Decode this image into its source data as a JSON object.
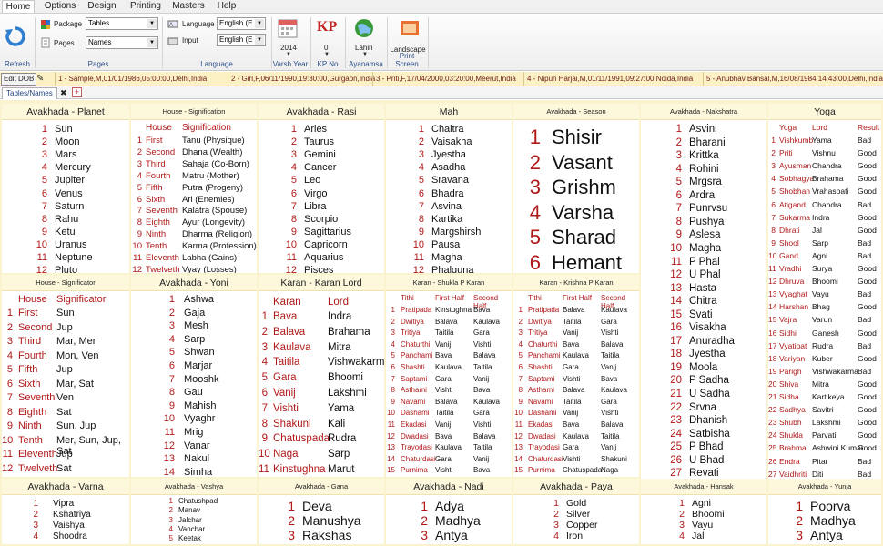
{
  "menu": {
    "items": [
      "Home",
      "Options",
      "Design",
      "Printing",
      "Masters",
      "Help"
    ]
  },
  "ribbon": {
    "refresh_label": "Refresh",
    "package_label": "Package",
    "package_value": "Tables",
    "pages_label": "Pages",
    "pages_value": "Names",
    "pages_group": "Pages",
    "language_label": "Language",
    "language_value": "English (E",
    "input_label": "Input",
    "input_value": "English (E",
    "language_group": "Language",
    "varsh_value": "2014",
    "varsh_label": "Varsh Year",
    "kp_icon_text": "KP",
    "kp_value": "0",
    "kp_label": "KP No",
    "lahiri_label": "Lahiri",
    "ayanamsa_label": "Ayanamsa",
    "landscape_label": "Landscape",
    "print_screen_label": "Print Screen"
  },
  "records": {
    "edit_dob": "Edit DOB",
    "items": [
      "1 - Sample,M,01/01/1986,05:00:00,Delhi,India",
      "2 - Girl,F,06/11/1990,19:30:00,Gurgaon,India",
      "3 - Priti,F,17/04/2000,03:20:00,Meerut,India",
      "4 - Nipun Harjai,M,01/11/1991,09:27:00,Noida,India",
      "5 - Anubhav Bansal,M,16/08/1984,14:43:00,Delhi,India"
    ]
  },
  "tab": {
    "label": "Tables/Names",
    "close": "✖",
    "add": "+"
  },
  "cells": {
    "planet": {
      "title": "Avakhada - Planet",
      "items": [
        "Sun",
        "Moon",
        "Mars",
        "Mercury",
        "Jupiter",
        "Venus",
        "Saturn",
        "Rahu",
        "Ketu",
        "Uranus",
        "Neptune",
        "Pluto"
      ]
    },
    "house_sig": {
      "title": "House - Signification",
      "h1": "House",
      "h2": "Signification",
      "rows": [
        [
          "First",
          "Tanu (Physique)"
        ],
        [
          "Second",
          "Dhana (Wealth)"
        ],
        [
          "Third",
          "Sahaja (Co-Born)"
        ],
        [
          "Fourth",
          "Matru (Mother)"
        ],
        [
          "Fifth",
          "Putra (Progeny)"
        ],
        [
          "Sixth",
          "Ari (Enemies)"
        ],
        [
          "Seventh",
          "Kalatra (Spouse)"
        ],
        [
          "Eighth",
          "Ayur (Longevity)"
        ],
        [
          "Ninth",
          "Dharma (Religion)"
        ],
        [
          "Tenth",
          "Karma (Profession)"
        ],
        [
          "Eleventh",
          "Labha (Gains)"
        ],
        [
          "Twelveth",
          "Vyay (Losses)"
        ]
      ]
    },
    "rasi": {
      "title": "Avakhada - Rasi",
      "items": [
        "Aries",
        "Taurus",
        "Gemini",
        "Cancer",
        "Leo",
        "Virgo",
        "Libra",
        "Scorpio",
        "Sagittarius",
        "Capricorn",
        "Aquarius",
        "Pisces"
      ]
    },
    "mah": {
      "title": "Mah",
      "items": [
        "Chaitra",
        "Vaisakha",
        "Jyestha",
        "Asadha",
        "Sravana",
        "Bhadra",
        "Asvina",
        "Kartika",
        "Margshirsh",
        "Pausa",
        "Magha",
        "Phalguna"
      ]
    },
    "season": {
      "title": "Avakhada - Season",
      "items": [
        "Shisir",
        "Vasant",
        "Grishm",
        "Varsha",
        "Sharad",
        "Hemant"
      ]
    },
    "nakshatra": {
      "title": "Avakhada - Nakshatra",
      "items": [
        "Asvini",
        "Bharani",
        "Krittka",
        "Rohini",
        "Mrgsra",
        "Ardra",
        "Punrvsu",
        "Pushya",
        "Aslesa",
        "Magha",
        "P Phal",
        "U Phal",
        "Hasta",
        "Chitra",
        "Svati",
        "Visakha",
        "Anuradha",
        "Jyestha",
        "Moola",
        "P Sadha",
        "U Sadha",
        "Srvna",
        "Dhanish",
        "Satbisha",
        "P Bhad",
        "U Bhad",
        "Revati"
      ]
    },
    "yoga": {
      "title": "Yoga",
      "h1": "Yoga",
      "h2": "Lord",
      "h3": "Result",
      "rows": [
        [
          "Vishkumb",
          "Yama",
          "Bad"
        ],
        [
          "Priti",
          "Vishnu",
          "Good"
        ],
        [
          "Ayusman",
          "Chandra",
          "Good"
        ],
        [
          "Sobhagya",
          "Brahama",
          "Good"
        ],
        [
          "Shobhan",
          "Vrahaspati",
          "Good"
        ],
        [
          "Atigand",
          "Chandra",
          "Bad"
        ],
        [
          "Sukarma",
          "Indra",
          "Good"
        ],
        [
          "Dhrati",
          "Jal",
          "Good"
        ],
        [
          "Shool",
          "Sarp",
          "Bad"
        ],
        [
          "Gand",
          "Agni",
          "Bad"
        ],
        [
          "Vradhi",
          "Surya",
          "Good"
        ],
        [
          "Dhruva",
          "Bhoomi",
          "Good"
        ],
        [
          "Vyaghat",
          "Vayu",
          "Bad"
        ],
        [
          "Harshan",
          "Bhag",
          "Good"
        ],
        [
          "Vajra",
          "Varun",
          "Bad"
        ],
        [
          "Sidhi",
          "Ganesh",
          "Good"
        ],
        [
          "Vyatipat",
          "Rudra",
          "Bad"
        ],
        [
          "Variyan",
          "Kuber",
          "Good"
        ],
        [
          "Parigh",
          "Vishwakarma",
          "Bad"
        ],
        [
          "Shiva",
          "Mitra",
          "Good"
        ],
        [
          "Sidha",
          "Kartikeya",
          "Good"
        ],
        [
          "Sadhya",
          "Savitri",
          "Good"
        ],
        [
          "Shubh",
          "Lakshmi",
          "Good"
        ],
        [
          "Shukla",
          "Parvati",
          "Good"
        ],
        [
          "Brahma",
          "Ashwini Kumar",
          "Good"
        ],
        [
          "Endra",
          "Pitar",
          "Bad"
        ],
        [
          "Vaidhriti",
          "Diti",
          "Bad"
        ]
      ]
    },
    "house_signif": {
      "title": "House - Significator",
      "h1": "House",
      "h2": "Significator",
      "rows": [
        [
          "First",
          "Sun"
        ],
        [
          "Second",
          "Jup"
        ],
        [
          "Third",
          "Mar, Mer"
        ],
        [
          "Fourth",
          "Mon, Ven"
        ],
        [
          "Fifth",
          "Jup"
        ],
        [
          "Sixth",
          "Mar, Sat"
        ],
        [
          "Seventh",
          "Ven"
        ],
        [
          "Eighth",
          "Sat"
        ],
        [
          "Ninth",
          "Sun, Jup"
        ],
        [
          "Tenth",
          "Mer, Sun, Jup, Sat"
        ],
        [
          "Eleventh",
          "Jup"
        ],
        [
          "Twelveth",
          "Sat"
        ]
      ]
    },
    "yoni": {
      "title": "Avakhada - Yoni",
      "items": [
        "Ashwa",
        "Gaja",
        "Mesh",
        "Sarp",
        "Shwan",
        "Marjar",
        "Mooshk",
        "Gau",
        "Mahish",
        "Vyaghr",
        "Mrig",
        "Vanar",
        "Nakul",
        "Simha"
      ]
    },
    "karan_lord": {
      "title": "Karan - Karan Lord",
      "h1": "Karan",
      "h2": "Lord",
      "rows": [
        [
          "Bava",
          "Indra"
        ],
        [
          "Balava",
          "Brahama"
        ],
        [
          "Kaulava",
          "Mitra"
        ],
        [
          "Taitila",
          "Vishwakarma"
        ],
        [
          "Gara",
          "Bhoomi"
        ],
        [
          "Vanij",
          "Lakshmi"
        ],
        [
          "Vishti",
          "Yama"
        ],
        [
          "Shakuni",
          "Kali"
        ],
        [
          "Chatuspada",
          "Rudra"
        ],
        [
          "Naga",
          "Sarp"
        ],
        [
          "Kinstughna",
          "Marut"
        ]
      ]
    },
    "karan_shukla": {
      "title": "Karan - Shukla P Karan",
      "h1": "Tithi",
      "h2": "First Half",
      "h3": "Second Half",
      "rows": [
        [
          "Pratipada",
          "Kinstughna",
          "Bava"
        ],
        [
          "Dwitiya",
          "Balava",
          "Kaulava"
        ],
        [
          "Tritiya",
          "Taitila",
          "Gara"
        ],
        [
          "Chaturthi",
          "Vanij",
          "Vishti"
        ],
        [
          "Panchami",
          "Bava",
          "Balava"
        ],
        [
          "Shashti",
          "Kaulava",
          "Taitila"
        ],
        [
          "Saptami",
          "Gara",
          "Vanij"
        ],
        [
          "Asthami",
          "Vishti",
          "Bava"
        ],
        [
          "Navami",
          "Balava",
          "Kaulava"
        ],
        [
          "Dashami",
          "Taitila",
          "Gara"
        ],
        [
          "Ekadasi",
          "Vanij",
          "Vishti"
        ],
        [
          "Dwadasi",
          "Bava",
          "Balava"
        ],
        [
          "Trayodasi",
          "Kaulava",
          "Taitila"
        ],
        [
          "Chaturdasi",
          "Gara",
          "Vanij"
        ],
        [
          "Purnima",
          "Vishti",
          "Bava"
        ]
      ]
    },
    "karan_krishna": {
      "title": "Karan - Krishna P Karan",
      "h1": "Tithi",
      "h2": "First Half",
      "h3": "Second Half",
      "rows": [
        [
          "Pratipada",
          "Balava",
          "Kaulava"
        ],
        [
          "Dwitiya",
          "Taitila",
          "Gara"
        ],
        [
          "Tritiya",
          "Vanij",
          "Vishti"
        ],
        [
          "Chaturthi",
          "Bava",
          "Balava"
        ],
        [
          "Panchami",
          "Kaulava",
          "Taitila"
        ],
        [
          "Shashti",
          "Gara",
          "Vanij"
        ],
        [
          "Saptami",
          "Vishti",
          "Bava"
        ],
        [
          "Asthami",
          "Balava",
          "Kaulava"
        ],
        [
          "Navami",
          "Taitila",
          "Gara"
        ],
        [
          "Dashami",
          "Vanij",
          "Vishti"
        ],
        [
          "Ekadasi",
          "Bava",
          "Balava"
        ],
        [
          "Dwadasi",
          "Kaulava",
          "Taitila"
        ],
        [
          "Trayodasi",
          "Gara",
          "Vanij"
        ],
        [
          "Chaturdasi",
          "Vishti",
          "Shakuni"
        ],
        [
          "Purnima",
          "Chatuspada",
          "Naga"
        ]
      ]
    },
    "varna": {
      "title": "Avakhada - Varna",
      "items": [
        "Vipra",
        "Kshatriya",
        "Vaishya",
        "Shoodra"
      ]
    },
    "vashya": {
      "title": "Avakhada - Vashya",
      "items": [
        "Chatushpad",
        "Manav",
        "Jalchar",
        "Vanchar",
        "Keetak"
      ]
    },
    "gana": {
      "title": "Avakhada - Gana",
      "items": [
        "Deva",
        "Manushya",
        "Rakshas"
      ]
    },
    "nadi": {
      "title": "Avakhada - Nadi",
      "items": [
        "Adya",
        "Madhya",
        "Antya"
      ]
    },
    "paya": {
      "title": "Avakhada - Paya",
      "items": [
        "Gold",
        "Silver",
        "Copper",
        "Iron"
      ]
    },
    "hansak": {
      "title": "Avakhada - Hansak",
      "items": [
        "Agni",
        "Bhoomi",
        "Vayu",
        "Jal"
      ]
    },
    "yunja": {
      "title": "Avakhada - Yunja",
      "items": [
        "Poorva",
        "Madhya",
        "Antya"
      ]
    }
  }
}
